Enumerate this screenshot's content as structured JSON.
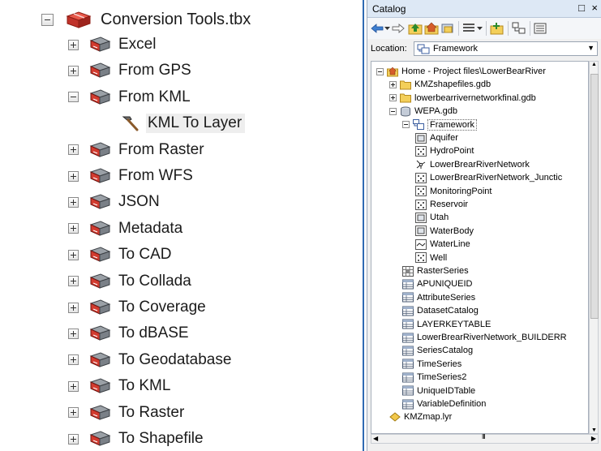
{
  "left_panel": {
    "toolbox": {
      "label": "Conversion Tools.tbx",
      "expanded": true
    },
    "toolsets": [
      {
        "label": "Excel",
        "expanded": false
      },
      {
        "label": "From GPS",
        "expanded": false
      },
      {
        "label": "From KML",
        "expanded": true,
        "tools": [
          {
            "label": "KML To Layer"
          }
        ]
      },
      {
        "label": "From Raster",
        "expanded": false
      },
      {
        "label": "From WFS",
        "expanded": false
      },
      {
        "label": "JSON",
        "expanded": false
      },
      {
        "label": "Metadata",
        "expanded": false
      },
      {
        "label": "To CAD",
        "expanded": false
      },
      {
        "label": "To Collada",
        "expanded": false
      },
      {
        "label": "To Coverage",
        "expanded": false
      },
      {
        "label": "To dBASE",
        "expanded": false
      },
      {
        "label": "To Geodatabase",
        "expanded": false
      },
      {
        "label": "To KML",
        "expanded": false
      },
      {
        "label": "To Raster",
        "expanded": false
      },
      {
        "label": "To Shapefile",
        "expanded": false
      }
    ]
  },
  "catalog": {
    "title": "Catalog",
    "window_controls": {
      "dock": "□",
      "close": "×"
    },
    "location_label": "Location:",
    "location_value": "Framework",
    "toolbar_icons": [
      "back-arrow-icon",
      "forward-arrow-icon",
      "up-one-level-icon",
      "home-icon",
      "connect-folder-icon",
      "view-options-icon",
      "new-item-icon",
      "toggle-contents-icon",
      "options-icon"
    ],
    "tree": [
      {
        "label": "Home - Project files\\LowerBearRiver",
        "level": 0,
        "icon": "home-folder",
        "expander": "minus"
      },
      {
        "label": "KMZshapefiles.gdb",
        "level": 1,
        "icon": "folder",
        "expander": "plus"
      },
      {
        "label": "lowerbearrivernetworkfinal.gdb",
        "level": 1,
        "icon": "folder",
        "expander": "plus"
      },
      {
        "label": "WEPA.gdb",
        "level": 1,
        "icon": "geodatabase",
        "expander": "minus"
      },
      {
        "label": "Framework",
        "level": 2,
        "icon": "feature-dataset",
        "expander": "minus",
        "selected": true
      },
      {
        "label": "Aquifer",
        "level": 3,
        "icon": "polygon-fc"
      },
      {
        "label": "HydroPoint",
        "level": 3,
        "icon": "point-fc"
      },
      {
        "label": "LowerBrearRiverNetwork",
        "level": 3,
        "icon": "network"
      },
      {
        "label": "LowerBrearRiverNetwork_Junctic",
        "level": 3,
        "icon": "point-fc"
      },
      {
        "label": "MonitoringPoint",
        "level": 3,
        "icon": "point-fc"
      },
      {
        "label": "Reservoir",
        "level": 3,
        "icon": "point-fc"
      },
      {
        "label": "Utah",
        "level": 3,
        "icon": "polygon-fc"
      },
      {
        "label": "WaterBody",
        "level": 3,
        "icon": "polygon-fc"
      },
      {
        "label": "WaterLine",
        "level": 3,
        "icon": "line-fc"
      },
      {
        "label": "Well",
        "level": 3,
        "icon": "point-fc"
      },
      {
        "label": "RasterSeries",
        "level": 2,
        "icon": "raster"
      },
      {
        "label": "APUNIQUEID",
        "level": 2,
        "icon": "table"
      },
      {
        "label": "AttributeSeries",
        "level": 2,
        "icon": "table"
      },
      {
        "label": "DatasetCatalog",
        "level": 2,
        "icon": "table"
      },
      {
        "label": "LAYERKEYTABLE",
        "level": 2,
        "icon": "table"
      },
      {
        "label": "LowerBrearRiverNetwork_BUILDERR",
        "level": 2,
        "icon": "table"
      },
      {
        "label": "SeriesCatalog",
        "level": 2,
        "icon": "table"
      },
      {
        "label": "TimeSeries",
        "level": 2,
        "icon": "table"
      },
      {
        "label": "TimeSeries2",
        "level": 2,
        "icon": "table"
      },
      {
        "label": "UniqueIDTable",
        "level": 2,
        "icon": "table"
      },
      {
        "label": "VariableDefinition",
        "level": 2,
        "icon": "table"
      },
      {
        "label": "KMZmap.lyr",
        "level": 1,
        "icon": "layer-file"
      }
    ],
    "hscroll_grip": "III"
  }
}
